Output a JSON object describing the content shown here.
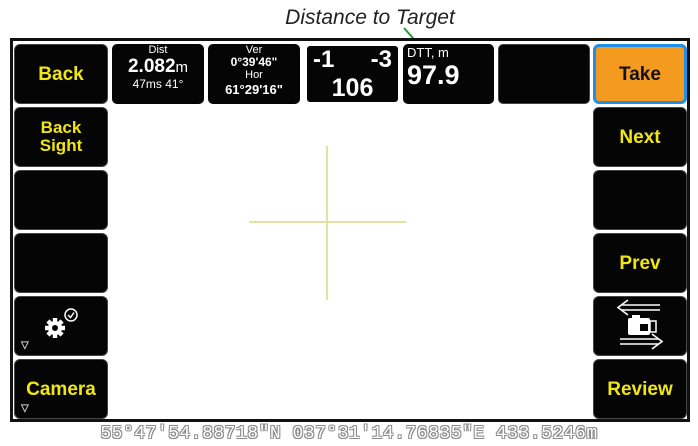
{
  "callout": {
    "text": "Distance to Target"
  },
  "left_buttons": {
    "back": "Back",
    "back_sight": "Back Sight",
    "camera": "Camera",
    "gear_icon": "gear-check-icon",
    "expand_marker": "▽"
  },
  "right_buttons": {
    "take": "Take",
    "next": "Next",
    "prev": "Prev",
    "review": "Review",
    "camera_switch_icon": "camera-switch-icon"
  },
  "status": {
    "dist": {
      "label": "Dist",
      "value": "2.082",
      "unit": "m",
      "time": "47ms 41°"
    },
    "angles": {
      "ver_label": "Ver",
      "ver_value": "0°39'46\"",
      "hor_label": "Hor",
      "hor_value": "61°29'16\""
    },
    "offsets": {
      "left": "-1",
      "right": "-3",
      "bottom": "106"
    },
    "dtt": {
      "label": "DTT, m",
      "value": "97.9"
    }
  },
  "coordinates": "55°47'54.88718\"N 037°31'14.76835\"E 433.5246m",
  "colors": {
    "button_text": "#f0e614",
    "take_bg": "#f49a1f",
    "take_border": "#1e8fe8",
    "crosshair": "#e2e2a2"
  }
}
